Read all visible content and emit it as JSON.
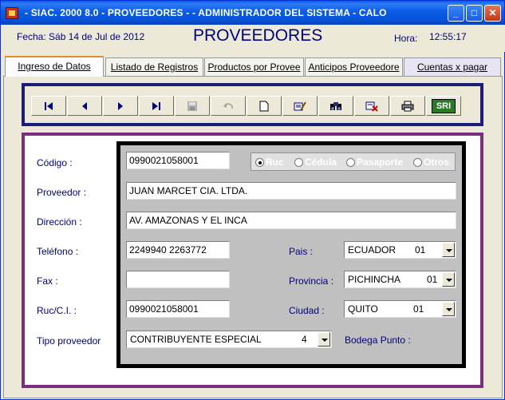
{
  "window": {
    "title": "- SIAC. 2000 8.0 - PROVEEDORES -  - ADMINISTRADOR DEL SISTEMA - CALO"
  },
  "titlebar_buttons": {
    "minimize": "_",
    "maximize": "□",
    "close": "✕"
  },
  "header": {
    "date": "Fecha: Sáb 14 de Jul de 2012",
    "title": "PROVEEDORES",
    "time_label": "Hora:",
    "time_value": "12:55:17"
  },
  "tabs": [
    {
      "label": "Ingreso de Datos"
    },
    {
      "label": "Listado de Registros"
    },
    {
      "label": "Productos por Provee"
    },
    {
      "label": "Anticipos Proveedore"
    },
    {
      "label": "Cuentas x pagar"
    }
  ],
  "toolbar": [
    {
      "icon": "first-record-icon"
    },
    {
      "icon": "previous-record-icon"
    },
    {
      "icon": "next-record-icon"
    },
    {
      "icon": "last-record-icon"
    },
    {
      "icon": "save-icon"
    },
    {
      "icon": "undo-icon"
    },
    {
      "icon": "new-document-icon"
    },
    {
      "icon": "edit-icon"
    },
    {
      "icon": "search-icon"
    },
    {
      "icon": "delete-icon"
    },
    {
      "icon": "print-icon"
    },
    {
      "icon": "sri-icon",
      "text": "SRI"
    }
  ],
  "form": {
    "labels": {
      "codigo": "Código :",
      "proveedor": "Proveedor :",
      "direccion": "Dirección :",
      "telefono": "Teléfono :",
      "fax": "Fax :",
      "ruc": "Ruc/C.I. :",
      "tipo": "Tipo proveedor",
      "pais": "Pais :",
      "provincia": "Provincia :",
      "ciudad": "Ciudad :",
      "bodega": "Bodega Punto :"
    },
    "values": {
      "codigo": "0990021058001",
      "proveedor": "JUAN MARCET CIA. LTDA.",
      "direccion": "AV. AMAZONAS Y EL INCA",
      "telefono": "2249940 2263772",
      "fax": "",
      "ruc": "0990021058001"
    },
    "id_type": {
      "options": [
        "Ruc",
        "Cédula",
        "Pasaporte",
        "Otros"
      ],
      "selected": "Ruc"
    },
    "tipo_proveedor": {
      "value": "CONTRIBUYENTE ESPECIAL",
      "code": "4"
    },
    "pais": {
      "value": "ECUADOR",
      "code": "01"
    },
    "provincia": {
      "value": "PICHINCHA",
      "code": "01"
    },
    "ciudad": {
      "value": "QUITO",
      "code": "01"
    }
  }
}
